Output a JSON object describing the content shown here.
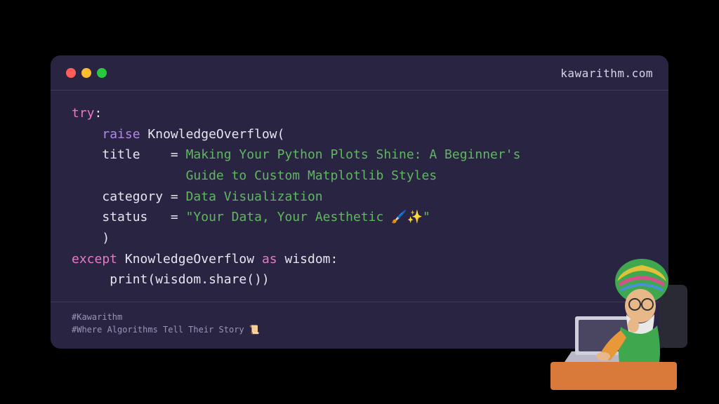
{
  "header": {
    "site": "kawarithm.com"
  },
  "code": {
    "try_kw": "try",
    "colon": ":",
    "raise_kw": "raise",
    "exception_class": "KnowledgeOverflow",
    "open_paren": "(",
    "title_key": "title",
    "equals": " = ",
    "title_val_l1": "Making Your Python Plots Shine: A Beginner's",
    "title_val_l2": "Guide to Custom Matplotlib Styles",
    "category_key": "category",
    "category_val": "Data Visualization",
    "status_key": "status",
    "status_val": "\"Your Data, Your Aesthetic 🖌️✨\"",
    "close_paren": ")",
    "except_kw": "except",
    "as_kw": "as",
    "wisdom": "wisdom",
    "print_call": "print(wisdom.share())"
  },
  "footer": {
    "tag1": "#Kawarithm",
    "tag2": "#Where Algorithms Tell Their Story 📜"
  }
}
